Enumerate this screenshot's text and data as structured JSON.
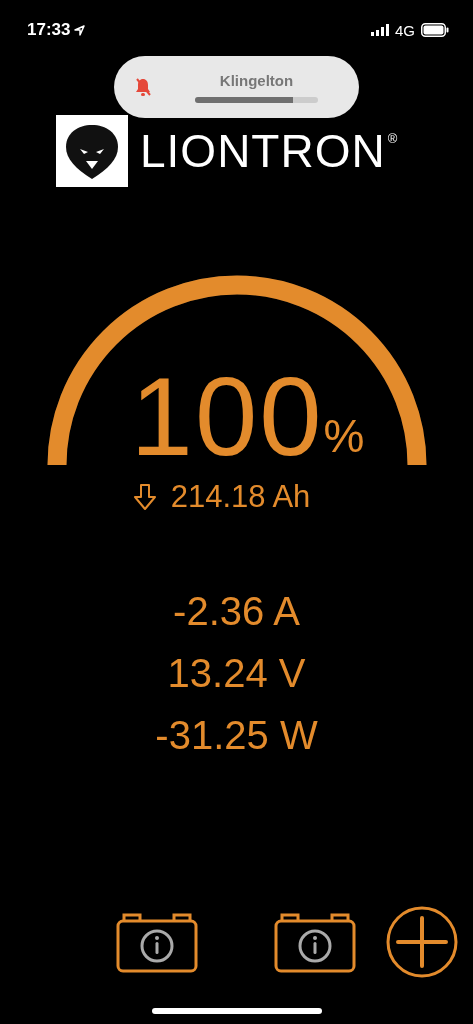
{
  "status_bar": {
    "time": "17:33",
    "network": "4G"
  },
  "volume_hud": {
    "label": "Klingelton",
    "level": 0.8,
    "muted": true
  },
  "logo": {
    "text": "LIONTRON",
    "mark": "®"
  },
  "gauge": {
    "level": 1,
    "value": "100",
    "unit": "%",
    "capacity": "214.18 Ah"
  },
  "readings": [
    "-2.36 A",
    "13.24 V",
    "-31.25 W"
  ],
  "toolbar": [
    {
      "kind": "battery"
    },
    {
      "kind": "battery"
    },
    {
      "kind": "add"
    }
  ]
}
